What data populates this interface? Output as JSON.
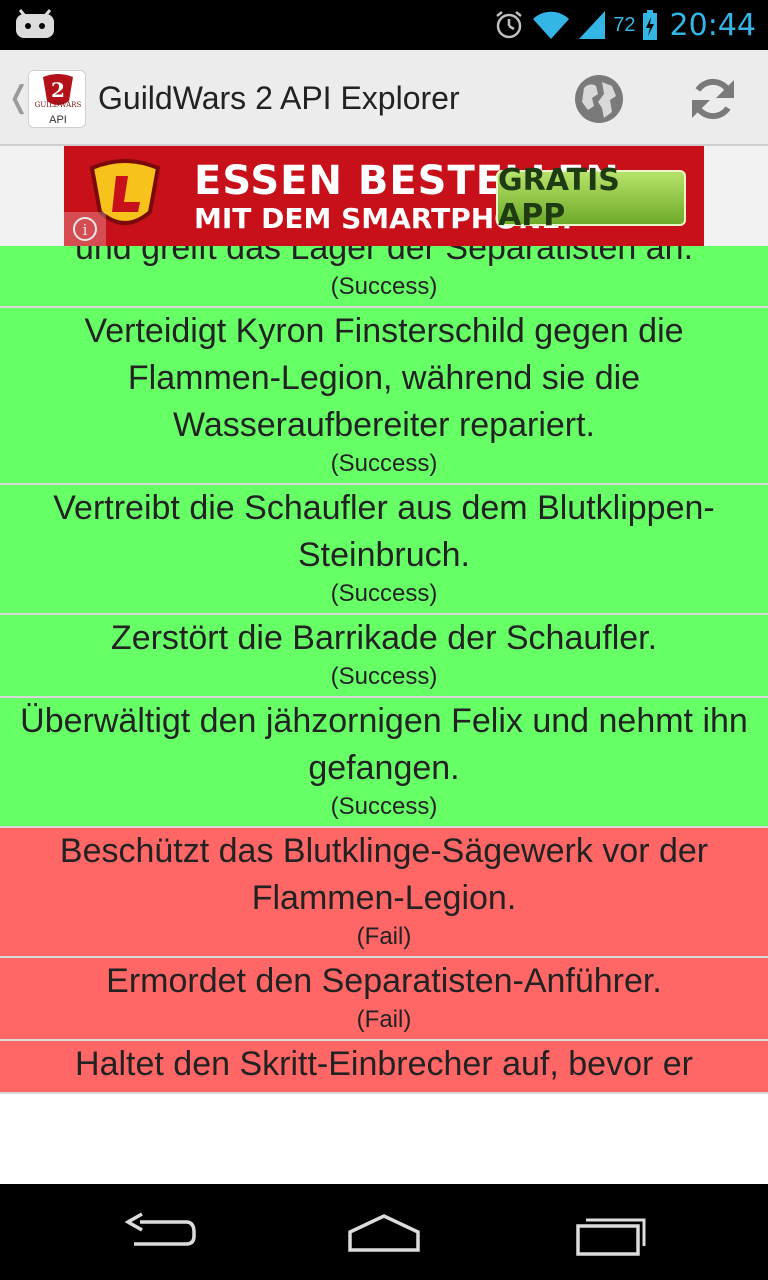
{
  "statusbar": {
    "clock": "20:44",
    "battery_percent": "72",
    "icons": [
      "cyanogenmod-bugdroid-icon",
      "alarm-icon",
      "wifi-icon",
      "signal-icon",
      "battery-charging-icon"
    ]
  },
  "actionbar": {
    "title": "GuildWars 2 API Explorer",
    "up_glyph": "❬",
    "logo_text_top": "GUILDWARS",
    "logo_text_bottom": "API",
    "icons": [
      "globe-icon",
      "refresh-icon"
    ]
  },
  "ad": {
    "line1": "ESSEN BESTELLEN",
    "line2": "MIT DEM SMARTPHONE!",
    "button": "GRATIS APP",
    "info_glyph": "i"
  },
  "events": [
    {
      "desc": "und greift das Lager der Separatisten an.",
      "status": "(Success)",
      "state": "success"
    },
    {
      "desc": "Verteidigt Kyron Finsterschild gegen die Flammen-Legion, während sie die Wasseraufbereiter repariert.",
      "status": "(Success)",
      "state": "success"
    },
    {
      "desc": "Vertreibt die Schaufler aus dem Blutklippen-Steinbruch.",
      "status": "(Success)",
      "state": "success"
    },
    {
      "desc": "Zerstört die Barrikade der Schaufler.",
      "status": "(Success)",
      "state": "success"
    },
    {
      "desc": "Überwältigt den jähzornigen Felix und nehmt ihn gefangen.",
      "status": "(Success)",
      "state": "success"
    },
    {
      "desc": "Beschützt das Blutklinge-Sägewerk vor der Flammen-Legion.",
      "status": "(Fail)",
      "state": "fail"
    },
    {
      "desc": "Ermordet den Separatisten-Anführer.",
      "status": "(Fail)",
      "state": "fail"
    },
    {
      "desc": "Haltet den Skritt-Einbrecher auf, bevor er",
      "status": "",
      "state": "fail"
    }
  ],
  "colors": {
    "success": "#66ff66",
    "fail": "#ff6666",
    "status_accent": "#33b5e5"
  },
  "navbar": {
    "icons": [
      "back-icon",
      "home-icon",
      "recent-apps-icon"
    ]
  }
}
